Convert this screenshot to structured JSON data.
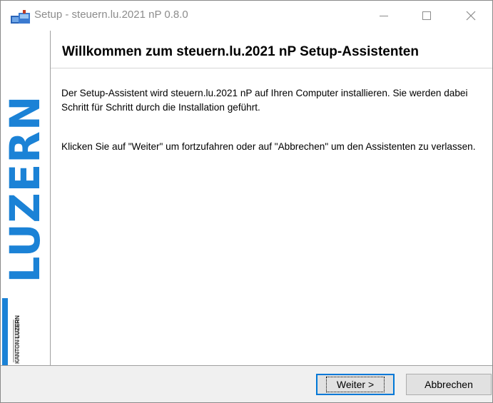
{
  "window": {
    "title": "Setup - steuern.lu.2021 nP 0.8.0",
    "minimize_glyph": "",
    "close_glyph": "✕"
  },
  "banner": {
    "word": "LUZERN",
    "kanton_label": "KANTON",
    "luzern_label": "LUZERN",
    "accent_color": "#1b82d6"
  },
  "main": {
    "heading": "Willkommen zum steuern.lu.2021 nP Setup-Assistenten",
    "paragraph1": "Der Setup-Assistent wird steuern.lu.2021 nP auf Ihren Computer installieren. Sie werden dabei Schritt für Schritt durch die Installation geführt.",
    "paragraph2": "Klicken Sie auf \"Weiter\" um fortzufahren oder auf \"Abbrechen\" um den Assistenten zu verlassen."
  },
  "buttons": {
    "next_label": "Weiter >",
    "cancel_label": "Abbrechen"
  }
}
